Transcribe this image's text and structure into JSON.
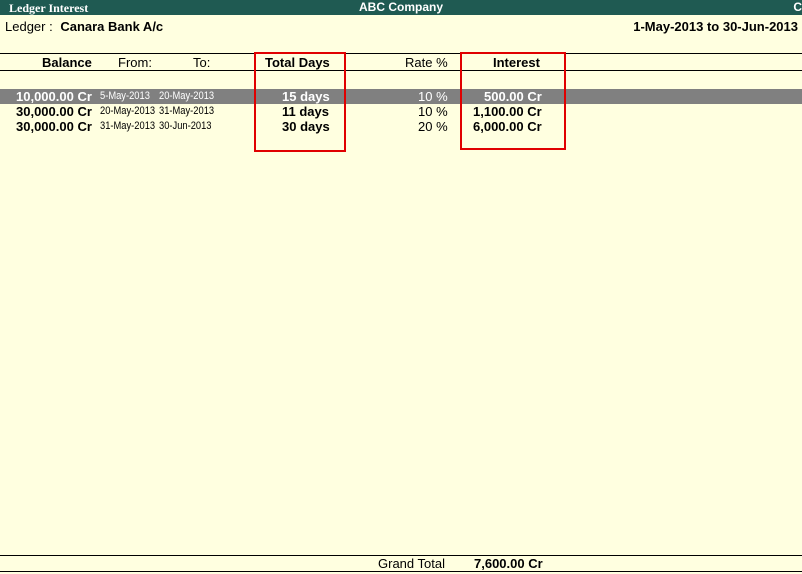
{
  "window": {
    "title": "Ledger Interest",
    "company": "ABC Company",
    "edge_char": "C"
  },
  "ledger": {
    "label": "Ledger :",
    "name": "Canara Bank A/c"
  },
  "period": "1-May-2013 to 30-Jun-2013",
  "columns": {
    "balance": "Balance",
    "from": "From:",
    "to": "To:",
    "total_days": "Total Days",
    "rate": "Rate %",
    "interest": "Interest"
  },
  "rows": [
    {
      "balance": "10,000.00 Cr",
      "from": "5-May-2013",
      "to": "20-May-2013",
      "days": "15 days",
      "rate": "10 %",
      "interest": "500.00 Cr",
      "selected": true
    },
    {
      "balance": "30,000.00 Cr",
      "from": "20-May-2013",
      "to": "31-May-2013",
      "days": "11 days",
      "rate": "10 %",
      "interest": "1,100.00 Cr",
      "selected": false
    },
    {
      "balance": "30,000.00 Cr",
      "from": "31-May-2013",
      "to": "30-Jun-2013",
      "days": "30 days",
      "rate": "20 %",
      "interest": "6,000.00 Cr",
      "selected": false
    }
  ],
  "footer": {
    "label": "Grand Total",
    "value": "7,600.00 Cr"
  },
  "colors": {
    "background": "#FFFFE0",
    "titlebar": "#1F5A52",
    "selected_row": "#808080",
    "highlight_box": "#E00000"
  }
}
